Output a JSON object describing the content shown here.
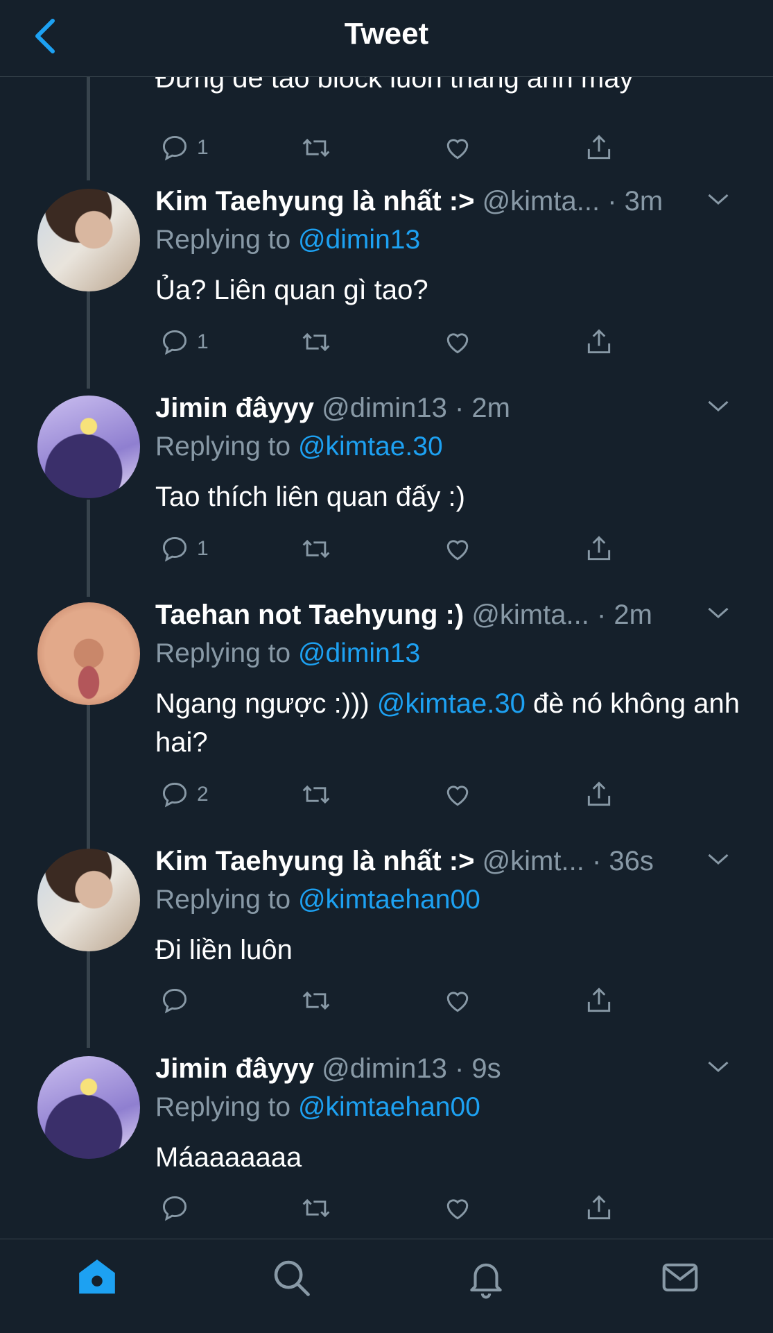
{
  "header": {
    "title": "Tweet"
  },
  "colors": {
    "background": "#15202b",
    "accent": "#1da1f2",
    "muted": "#8899a6",
    "divider": "#38444d"
  },
  "partial_tweet": {
    "text": "Đừng để tao block luôn thằng anh mày",
    "reply_count": "1"
  },
  "tweets": [
    {
      "name": "Kim Taehyung là nhất :>",
      "handle": "@kimta...",
      "time": "· 3m",
      "reply_label": "Replying to",
      "reply_to": "@dimin13",
      "text": "Ủa? Liên quan gì tao?",
      "reply_count": "1"
    },
    {
      "name": "Jimin đâyyy",
      "handle": "@dimin13",
      "time": "· 2m",
      "reply_label": "Replying to",
      "reply_to": "@kimtae.30",
      "text": "Tao thích liên quan đấy :)",
      "reply_count": "1"
    },
    {
      "name": "Taehan not Taehyung :)",
      "handle": "@kimta...",
      "time": "· 2m",
      "reply_label": "Replying to",
      "reply_to": "@dimin13",
      "text_before": "Ngang ngược :))) ",
      "text_mention": "@kimtae.30",
      "text_after": " đè nó không anh hai?",
      "reply_count": "2"
    },
    {
      "name": "Kim Taehyung là nhất :>",
      "handle": "@kimt...",
      "time": "· 36s",
      "reply_label": "Replying to",
      "reply_to": "@kimtaehan00",
      "text": "Đi liền luôn",
      "reply_count": ""
    },
    {
      "name": "Jimin đâyyy",
      "handle": "@dimin13",
      "time": "· 9s",
      "reply_label": "Replying to",
      "reply_to": "@kimtaehan00",
      "text": "Máaaaaaaa",
      "reply_count": ""
    }
  ],
  "icons": {
    "back": "chevron-left-icon",
    "reply": "reply-icon",
    "retweet": "retweet-icon",
    "like": "heart-icon",
    "share": "share-icon",
    "tabs": [
      "home-icon",
      "search-icon",
      "bell-icon",
      "mail-icon"
    ]
  }
}
